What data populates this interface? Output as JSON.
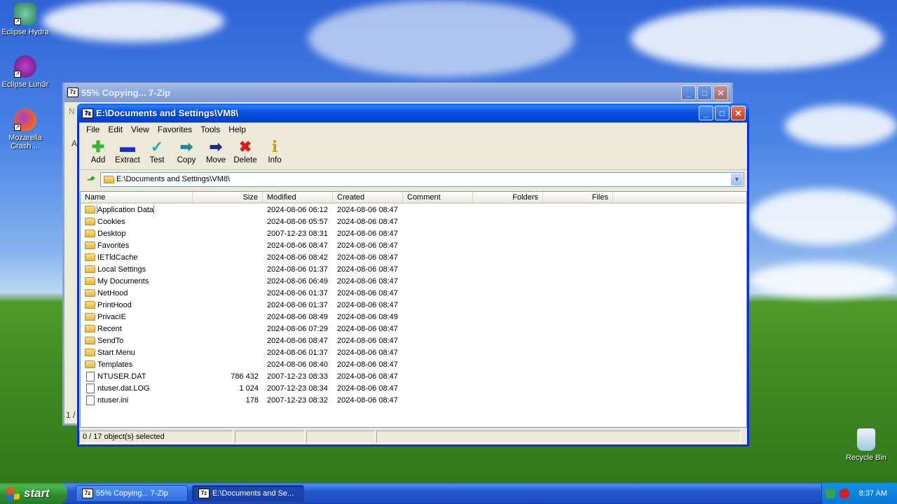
{
  "desktop": {
    "icons": [
      {
        "label": "Eclipse Hydra"
      },
      {
        "label": "Eclipse Lun3r"
      },
      {
        "label": "Mozarella Crash ..."
      },
      {
        "label": "Recycle Bin"
      }
    ]
  },
  "bg_window": {
    "title": "55% Copying... 7-Zip",
    "app_badge": "7z",
    "side_letters": [
      "N",
      "A",
      "1 /"
    ]
  },
  "window": {
    "title": "E:\\Documents and Settings\\VM8\\",
    "app_badge": "7z",
    "menu": [
      "File",
      "Edit",
      "View",
      "Favorites",
      "Tools",
      "Help"
    ],
    "toolbar": [
      {
        "label": "Add",
        "icon": "add-icon"
      },
      {
        "label": "Extract",
        "icon": "extract-icon"
      },
      {
        "label": "Test",
        "icon": "test-icon"
      },
      {
        "label": "Copy",
        "icon": "copy-icon"
      },
      {
        "label": "Move",
        "icon": "move-icon"
      },
      {
        "label": "Delete",
        "icon": "delete-icon"
      },
      {
        "label": "Info",
        "icon": "info-icon"
      }
    ],
    "address": "E:\\Documents and Settings\\VM8\\",
    "columns": [
      "Name",
      "Size",
      "Modified",
      "Created",
      "Comment",
      "Folders",
      "Files"
    ],
    "rows": [
      {
        "name": "Application Data",
        "size": "",
        "modified": "2024-08-06 06:12",
        "created": "2024-08-06 08:47",
        "type": "folder"
      },
      {
        "name": "Cookies",
        "size": "",
        "modified": "2024-08-06 05:57",
        "created": "2024-08-06 08:47",
        "type": "folder"
      },
      {
        "name": "Desktop",
        "size": "",
        "modified": "2007-12-23 08:31",
        "created": "2024-08-06 08:47",
        "type": "folder"
      },
      {
        "name": "Favorites",
        "size": "",
        "modified": "2024-08-06 08:47",
        "created": "2024-08-06 08:47",
        "type": "folder"
      },
      {
        "name": "IETldCache",
        "size": "",
        "modified": "2024-08-06 08:42",
        "created": "2024-08-06 08:47",
        "type": "folder"
      },
      {
        "name": "Local Settings",
        "size": "",
        "modified": "2024-08-06 01:37",
        "created": "2024-08-06 08:47",
        "type": "folder"
      },
      {
        "name": "My Documents",
        "size": "",
        "modified": "2024-08-06 06:49",
        "created": "2024-08-06 08:47",
        "type": "folder"
      },
      {
        "name": "NetHood",
        "size": "",
        "modified": "2024-08-06 01:37",
        "created": "2024-08-06 08:47",
        "type": "folder"
      },
      {
        "name": "PrintHood",
        "size": "",
        "modified": "2024-08-06 01:37",
        "created": "2024-08-06 08:47",
        "type": "folder"
      },
      {
        "name": "PrivacIE",
        "size": "",
        "modified": "2024-08-06 08:49",
        "created": "2024-08-06 08:49",
        "type": "folder"
      },
      {
        "name": "Recent",
        "size": "",
        "modified": "2024-08-06 07:29",
        "created": "2024-08-06 08:47",
        "type": "folder"
      },
      {
        "name": "SendTo",
        "size": "",
        "modified": "2024-08-06 08:47",
        "created": "2024-08-06 08:47",
        "type": "folder"
      },
      {
        "name": "Start Menu",
        "size": "",
        "modified": "2024-08-06 01:37",
        "created": "2024-08-06 08:47",
        "type": "folder"
      },
      {
        "name": "Templates",
        "size": "",
        "modified": "2024-08-06 08:40",
        "created": "2024-08-06 08:47",
        "type": "folder"
      },
      {
        "name": "NTUSER.DAT",
        "size": "786 432",
        "modified": "2007-12-23 08:33",
        "created": "2024-08-06 08:47",
        "type": "file"
      },
      {
        "name": "ntuser.dat.LOG",
        "size": "1 024",
        "modified": "2007-12-23 08:34",
        "created": "2024-08-06 08:47",
        "type": "file"
      },
      {
        "name": "ntuser.ini",
        "size": "178",
        "modified": "2007-12-23 08:32",
        "created": "2024-08-06 08:47",
        "type": "file"
      }
    ],
    "status": "0 / 17 object(s) selected"
  },
  "taskbar": {
    "start_label": "start",
    "tasks": [
      {
        "label": "55% Copying... 7-Zip",
        "badge": "7z"
      },
      {
        "label": "E:\\Documents and Se...",
        "badge": "7z"
      }
    ],
    "clock": "8:37 AM"
  },
  "colors": {
    "title_active": "#0046d4",
    "window_bg": "#ece9d8",
    "taskbar": "#2558d0",
    "start_green": "#2e8b2e"
  }
}
